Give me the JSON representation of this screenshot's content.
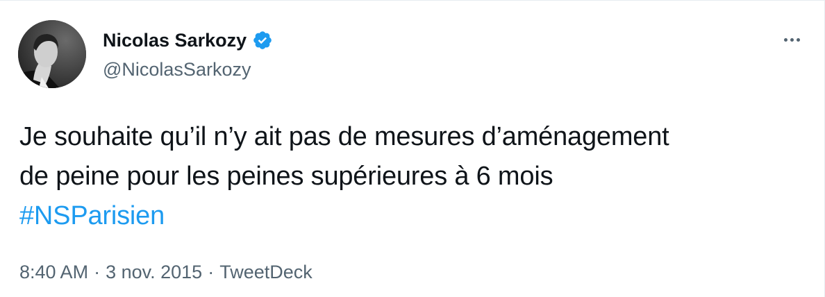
{
  "tweet": {
    "author": {
      "display_name": "Nicolas Sarkozy",
      "handle": "@NicolasSarkozy",
      "verified": true,
      "verified_color": "#1d9bf0"
    },
    "text_lines": [
      "Je souhaite qu’il n’y ait pas de mesures d’aménagement",
      "de peine pour les peines supérieures à 6 mois"
    ],
    "hashtag": "#NSParisien",
    "time": "8:40 AM",
    "date": "3 nov. 2015",
    "source": "TweetDeck",
    "separator": "·",
    "more_icon": "more-horizontal-icon"
  },
  "colors": {
    "text": "#0f1419",
    "secondary": "#536471",
    "accent": "#1d9bf0",
    "border": "#e6ecf0"
  }
}
